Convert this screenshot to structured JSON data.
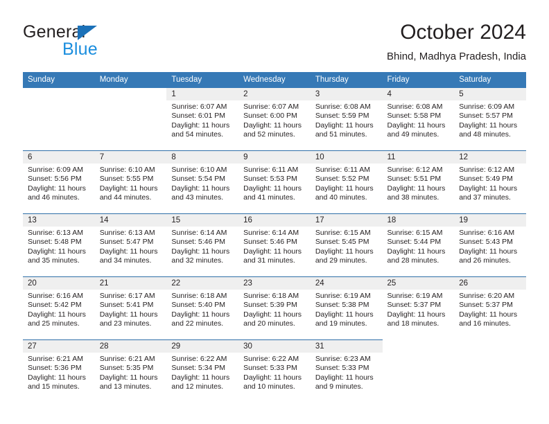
{
  "brand": {
    "name_top": "General",
    "name_bottom": "Blue",
    "triangle_icon": "triangle-icon"
  },
  "header": {
    "title": "October 2024",
    "location": "Bhind, Madhya Pradesh, India"
  },
  "colors": {
    "header_blue": "#3679b6",
    "separator_blue": "#2e6fa8",
    "daynum_band": "#efefef",
    "brand_dark": "#231f20",
    "brand_blue": "#1b8ede",
    "brand_triangle": "#1b71b8"
  },
  "weekday_headers": [
    "Sunday",
    "Monday",
    "Tuesday",
    "Wednesday",
    "Thursday",
    "Friday",
    "Saturday"
  ],
  "weeks": [
    [
      {
        "day": "",
        "sunrise": "",
        "sunset": "",
        "daylight_1": "",
        "daylight_2": ""
      },
      {
        "day": "",
        "sunrise": "",
        "sunset": "",
        "daylight_1": "",
        "daylight_2": ""
      },
      {
        "day": "1",
        "sunrise": "Sunrise: 6:07 AM",
        "sunset": "Sunset: 6:01 PM",
        "daylight_1": "Daylight: 11 hours",
        "daylight_2": "and 54 minutes."
      },
      {
        "day": "2",
        "sunrise": "Sunrise: 6:07 AM",
        "sunset": "Sunset: 6:00 PM",
        "daylight_1": "Daylight: 11 hours",
        "daylight_2": "and 52 minutes."
      },
      {
        "day": "3",
        "sunrise": "Sunrise: 6:08 AM",
        "sunset": "Sunset: 5:59 PM",
        "daylight_1": "Daylight: 11 hours",
        "daylight_2": "and 51 minutes."
      },
      {
        "day": "4",
        "sunrise": "Sunrise: 6:08 AM",
        "sunset": "Sunset: 5:58 PM",
        "daylight_1": "Daylight: 11 hours",
        "daylight_2": "and 49 minutes."
      },
      {
        "day": "5",
        "sunrise": "Sunrise: 6:09 AM",
        "sunset": "Sunset: 5:57 PM",
        "daylight_1": "Daylight: 11 hours",
        "daylight_2": "and 48 minutes."
      }
    ],
    [
      {
        "day": "6",
        "sunrise": "Sunrise: 6:09 AM",
        "sunset": "Sunset: 5:56 PM",
        "daylight_1": "Daylight: 11 hours",
        "daylight_2": "and 46 minutes."
      },
      {
        "day": "7",
        "sunrise": "Sunrise: 6:10 AM",
        "sunset": "Sunset: 5:55 PM",
        "daylight_1": "Daylight: 11 hours",
        "daylight_2": "and 44 minutes."
      },
      {
        "day": "8",
        "sunrise": "Sunrise: 6:10 AM",
        "sunset": "Sunset: 5:54 PM",
        "daylight_1": "Daylight: 11 hours",
        "daylight_2": "and 43 minutes."
      },
      {
        "day": "9",
        "sunrise": "Sunrise: 6:11 AM",
        "sunset": "Sunset: 5:53 PM",
        "daylight_1": "Daylight: 11 hours",
        "daylight_2": "and 41 minutes."
      },
      {
        "day": "10",
        "sunrise": "Sunrise: 6:11 AM",
        "sunset": "Sunset: 5:52 PM",
        "daylight_1": "Daylight: 11 hours",
        "daylight_2": "and 40 minutes."
      },
      {
        "day": "11",
        "sunrise": "Sunrise: 6:12 AM",
        "sunset": "Sunset: 5:51 PM",
        "daylight_1": "Daylight: 11 hours",
        "daylight_2": "and 38 minutes."
      },
      {
        "day": "12",
        "sunrise": "Sunrise: 6:12 AM",
        "sunset": "Sunset: 5:49 PM",
        "daylight_1": "Daylight: 11 hours",
        "daylight_2": "and 37 minutes."
      }
    ],
    [
      {
        "day": "13",
        "sunrise": "Sunrise: 6:13 AM",
        "sunset": "Sunset: 5:48 PM",
        "daylight_1": "Daylight: 11 hours",
        "daylight_2": "and 35 minutes."
      },
      {
        "day": "14",
        "sunrise": "Sunrise: 6:13 AM",
        "sunset": "Sunset: 5:47 PM",
        "daylight_1": "Daylight: 11 hours",
        "daylight_2": "and 34 minutes."
      },
      {
        "day": "15",
        "sunrise": "Sunrise: 6:14 AM",
        "sunset": "Sunset: 5:46 PM",
        "daylight_1": "Daylight: 11 hours",
        "daylight_2": "and 32 minutes."
      },
      {
        "day": "16",
        "sunrise": "Sunrise: 6:14 AM",
        "sunset": "Sunset: 5:46 PM",
        "daylight_1": "Daylight: 11 hours",
        "daylight_2": "and 31 minutes."
      },
      {
        "day": "17",
        "sunrise": "Sunrise: 6:15 AM",
        "sunset": "Sunset: 5:45 PM",
        "daylight_1": "Daylight: 11 hours",
        "daylight_2": "and 29 minutes."
      },
      {
        "day": "18",
        "sunrise": "Sunrise: 6:15 AM",
        "sunset": "Sunset: 5:44 PM",
        "daylight_1": "Daylight: 11 hours",
        "daylight_2": "and 28 minutes."
      },
      {
        "day": "19",
        "sunrise": "Sunrise: 6:16 AM",
        "sunset": "Sunset: 5:43 PM",
        "daylight_1": "Daylight: 11 hours",
        "daylight_2": "and 26 minutes."
      }
    ],
    [
      {
        "day": "20",
        "sunrise": "Sunrise: 6:16 AM",
        "sunset": "Sunset: 5:42 PM",
        "daylight_1": "Daylight: 11 hours",
        "daylight_2": "and 25 minutes."
      },
      {
        "day": "21",
        "sunrise": "Sunrise: 6:17 AM",
        "sunset": "Sunset: 5:41 PM",
        "daylight_1": "Daylight: 11 hours",
        "daylight_2": "and 23 minutes."
      },
      {
        "day": "22",
        "sunrise": "Sunrise: 6:18 AM",
        "sunset": "Sunset: 5:40 PM",
        "daylight_1": "Daylight: 11 hours",
        "daylight_2": "and 22 minutes."
      },
      {
        "day": "23",
        "sunrise": "Sunrise: 6:18 AM",
        "sunset": "Sunset: 5:39 PM",
        "daylight_1": "Daylight: 11 hours",
        "daylight_2": "and 20 minutes."
      },
      {
        "day": "24",
        "sunrise": "Sunrise: 6:19 AM",
        "sunset": "Sunset: 5:38 PM",
        "daylight_1": "Daylight: 11 hours",
        "daylight_2": "and 19 minutes."
      },
      {
        "day": "25",
        "sunrise": "Sunrise: 6:19 AM",
        "sunset": "Sunset: 5:37 PM",
        "daylight_1": "Daylight: 11 hours",
        "daylight_2": "and 18 minutes."
      },
      {
        "day": "26",
        "sunrise": "Sunrise: 6:20 AM",
        "sunset": "Sunset: 5:37 PM",
        "daylight_1": "Daylight: 11 hours",
        "daylight_2": "and 16 minutes."
      }
    ],
    [
      {
        "day": "27",
        "sunrise": "Sunrise: 6:21 AM",
        "sunset": "Sunset: 5:36 PM",
        "daylight_1": "Daylight: 11 hours",
        "daylight_2": "and 15 minutes."
      },
      {
        "day": "28",
        "sunrise": "Sunrise: 6:21 AM",
        "sunset": "Sunset: 5:35 PM",
        "daylight_1": "Daylight: 11 hours",
        "daylight_2": "and 13 minutes."
      },
      {
        "day": "29",
        "sunrise": "Sunrise: 6:22 AM",
        "sunset": "Sunset: 5:34 PM",
        "daylight_1": "Daylight: 11 hours",
        "daylight_2": "and 12 minutes."
      },
      {
        "day": "30",
        "sunrise": "Sunrise: 6:22 AM",
        "sunset": "Sunset: 5:33 PM",
        "daylight_1": "Daylight: 11 hours",
        "daylight_2": "and 10 minutes."
      },
      {
        "day": "31",
        "sunrise": "Sunrise: 6:23 AM",
        "sunset": "Sunset: 5:33 PM",
        "daylight_1": "Daylight: 11 hours",
        "daylight_2": "and 9 minutes."
      },
      {
        "day": "",
        "sunrise": "",
        "sunset": "",
        "daylight_1": "",
        "daylight_2": ""
      },
      {
        "day": "",
        "sunrise": "",
        "sunset": "",
        "daylight_1": "",
        "daylight_2": ""
      }
    ]
  ]
}
